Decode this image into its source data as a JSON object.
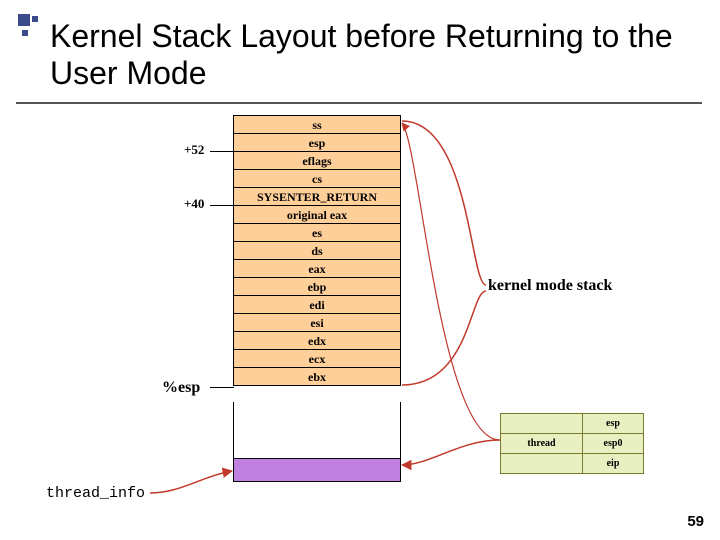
{
  "title": "Kernel Stack Layout before Returning to the User Mode",
  "offsets": {
    "o52": "+52",
    "o40": "+40"
  },
  "esp_label": "%esp",
  "thread_info_label": "thread_info",
  "kernel_stack_label": "kernel mode stack",
  "stack_cells": [
    "ss",
    "esp",
    "eflags",
    "cs",
    "SYSENTER_RETURN",
    "original eax",
    "es",
    "ds",
    "eax",
    "ebp",
    "edi",
    "esi",
    "edx",
    "ecx",
    "ebx"
  ],
  "struct_table": {
    "r1c1": "",
    "r1c2": "esp",
    "r2c1": "thread",
    "r2c2": "esp0",
    "r3c1": "",
    "r3c2": "eip"
  },
  "page": "59"
}
